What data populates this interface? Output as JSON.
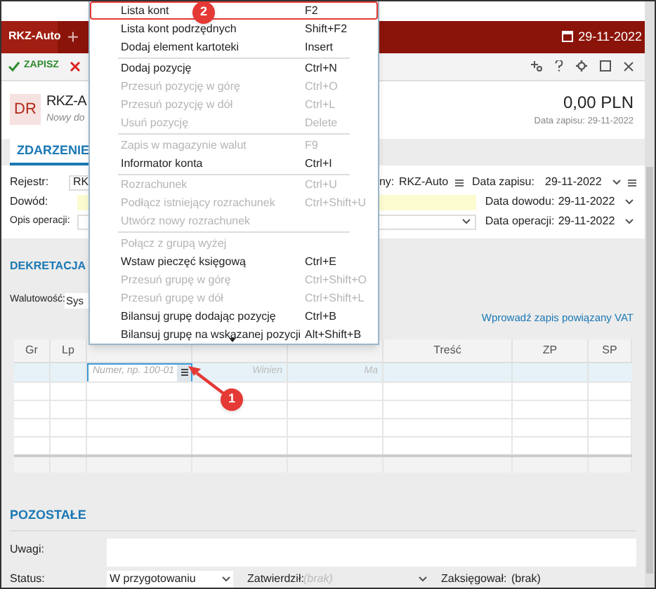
{
  "app_tabs": [
    {
      "label": "RKZ-Auto",
      "selected": true
    },
    {
      "label": "+",
      "selected": false
    }
  ],
  "date_badge": "29-11-2022",
  "toolbar": {
    "save": "ZAPISZ"
  },
  "document": {
    "badge": "DR",
    "title": "RKZ-A",
    "subtitle": "Nowy do",
    "amount": "0,00 PLN",
    "saved_date": "Data zapisu: 29-11-2022"
  },
  "section_tabs": [
    {
      "label": "ZDARZENIE",
      "selected": true
    }
  ],
  "event_form": {
    "register_label": "Rejestr:",
    "register_value": "RK",
    "register_type_label": "ny:",
    "register_type_value": "RKZ-Auto",
    "proof_label": "Dowód:",
    "description_label": "Opis operacji:",
    "entry_date_label": "Data zapisu:",
    "entry_date": "29-11-2022",
    "proof_date_label": "Data dowodu:",
    "proof_date": "29-11-2022",
    "operation_date_label": "Data operacji:",
    "operation_date": "29-11-2022"
  },
  "posting": {
    "heading": "DEKRETACJA",
    "currency_label": "Walutowość:",
    "currency_value": "Sys",
    "vat_link": "Wprowadź zapis powiązany VAT"
  },
  "table": {
    "columns": [
      {
        "label": "Gr"
      },
      {
        "label": "Lp"
      },
      {
        "label": "Treść"
      },
      {
        "label": "ZP"
      },
      {
        "label": "SP"
      }
    ],
    "entry_row": {
      "account_placeholder": "Numer, np. 100-01",
      "debit_placeholder": "Winien",
      "credit_placeholder": "Ma"
    }
  },
  "other": {
    "heading": "POZOSTAŁE",
    "notes_label": "Uwagi:",
    "status_label": "Status:",
    "status_value": "W przygotowaniu",
    "approved_label": "Zatwierdził:",
    "approved_value": "(brak)",
    "posted_label": "Zaksięgował:",
    "posted_value": "(brak)"
  },
  "context_menu": {
    "items": [
      {
        "kind": "item",
        "label": "Lista kont",
        "shortcut": "F2",
        "disabled": false,
        "selected": true
      },
      {
        "kind": "item",
        "label": "Lista kont podrzędnych",
        "shortcut": "Shift+F2",
        "disabled": false,
        "selected": false
      },
      {
        "kind": "item",
        "label": "Dodaj element kartoteki",
        "shortcut": "Insert",
        "disabled": false,
        "selected": false
      },
      {
        "kind": "separator"
      },
      {
        "kind": "item",
        "label": "Dodaj pozycję",
        "shortcut": "Ctrl+N",
        "disabled": false,
        "selected": false
      },
      {
        "kind": "item",
        "label": "Przesuń pozycję w górę",
        "shortcut": "Ctrl+O",
        "disabled": true,
        "selected": false
      },
      {
        "kind": "item",
        "label": "Przesuń pozycję w dół",
        "shortcut": "Ctrl+L",
        "disabled": true,
        "selected": false
      },
      {
        "kind": "item",
        "label": "Usuń pozycję",
        "shortcut": "Delete",
        "disabled": true,
        "selected": false
      },
      {
        "kind": "separator"
      },
      {
        "kind": "item",
        "label": "Zapis w magazynie walut",
        "shortcut": "F9",
        "disabled": true,
        "selected": false
      },
      {
        "kind": "item",
        "label": "Informator konta",
        "shortcut": "Ctrl+I",
        "disabled": false,
        "selected": false
      },
      {
        "kind": "separator"
      },
      {
        "kind": "item",
        "label": "Rozrachunek",
        "shortcut": "Ctrl+U",
        "disabled": true,
        "selected": false
      },
      {
        "kind": "item",
        "label": "Podłącz istniejący rozrachunek",
        "shortcut": "Ctrl+Shift+U",
        "disabled": true,
        "selected": false
      },
      {
        "kind": "item",
        "label": "Utwórz nowy rozrachunek",
        "disabled": true,
        "selected": false
      },
      {
        "kind": "separator"
      },
      {
        "kind": "item",
        "label": "Połącz z grupą wyżej",
        "disabled": true,
        "selected": false
      },
      {
        "kind": "item",
        "label": "Wstaw pieczęć księgową",
        "shortcut": "Ctrl+E",
        "disabled": false,
        "selected": false
      },
      {
        "kind": "item",
        "label": "Przesuń grupę w górę",
        "shortcut": "Ctrl+Shift+O",
        "disabled": true,
        "selected": false
      },
      {
        "kind": "item",
        "label": "Przesuń grupę w dół",
        "shortcut": "Ctrl+Shift+L",
        "disabled": true,
        "selected": false
      },
      {
        "kind": "item",
        "label": "Bilansuj grupę dodając pozycję",
        "shortcut": "Ctrl+B",
        "disabled": false,
        "selected": false
      },
      {
        "kind": "item",
        "label": "Bilansuj grupę na wskazanej pozycji",
        "shortcut": "Alt+Shift+B",
        "disabled": false,
        "selected": false
      }
    ]
  },
  "annotations": [
    {
      "label": "2"
    },
    {
      "label": "1"
    }
  ]
}
